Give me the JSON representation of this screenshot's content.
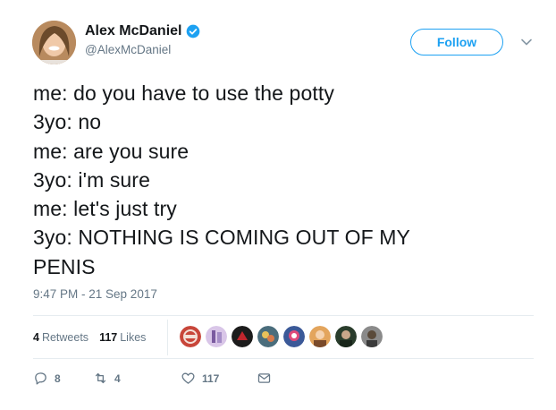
{
  "user": {
    "display_name": "Alex McDaniel",
    "handle": "@AlexMcDaniel",
    "verified": true
  },
  "follow_label": "Follow",
  "tweet": {
    "lines": [
      "me: do you have to use the potty",
      "3yo: no",
      "me: are you sure",
      "3yo: i'm sure",
      "me: let's just try",
      "3yo: NOTHING IS COMING OUT OF MY",
      "PENIS"
    ],
    "timestamp": "9:47 PM - 21 Sep 2017"
  },
  "stats": {
    "retweets_count": "4",
    "retweets_label": "Retweets",
    "likes_count": "117",
    "likes_label": "Likes"
  },
  "actions": {
    "replies": "8",
    "retweets": "4",
    "likes": "117"
  },
  "colors": {
    "accent": "#1da1f2",
    "secondary_text": "#657786",
    "divider": "#e6ecf0"
  },
  "icons": [
    "verified-badge-icon",
    "chevron-down-icon",
    "reply-icon",
    "retweet-icon",
    "heart-icon",
    "dm-envelope-icon"
  ]
}
